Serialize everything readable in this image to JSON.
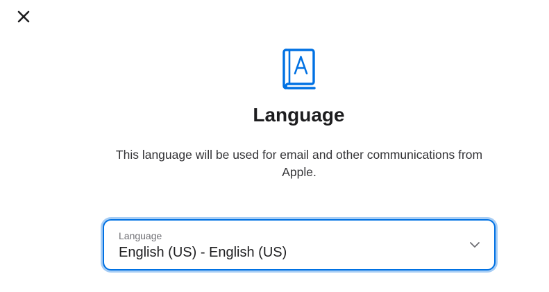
{
  "dialog": {
    "close_label": "close",
    "title": "Language",
    "description": "This language will be used for email and other communications from Apple."
  },
  "language_select": {
    "label": "Language",
    "value": "English (US) - English (US)"
  },
  "colors": {
    "accent": "#0071e3",
    "text": "#1d1d1f",
    "secondary_text": "#6e6e73"
  },
  "icons": {
    "close": "close-icon",
    "book": "book-a-icon",
    "chevron": "chevron-down-icon"
  }
}
